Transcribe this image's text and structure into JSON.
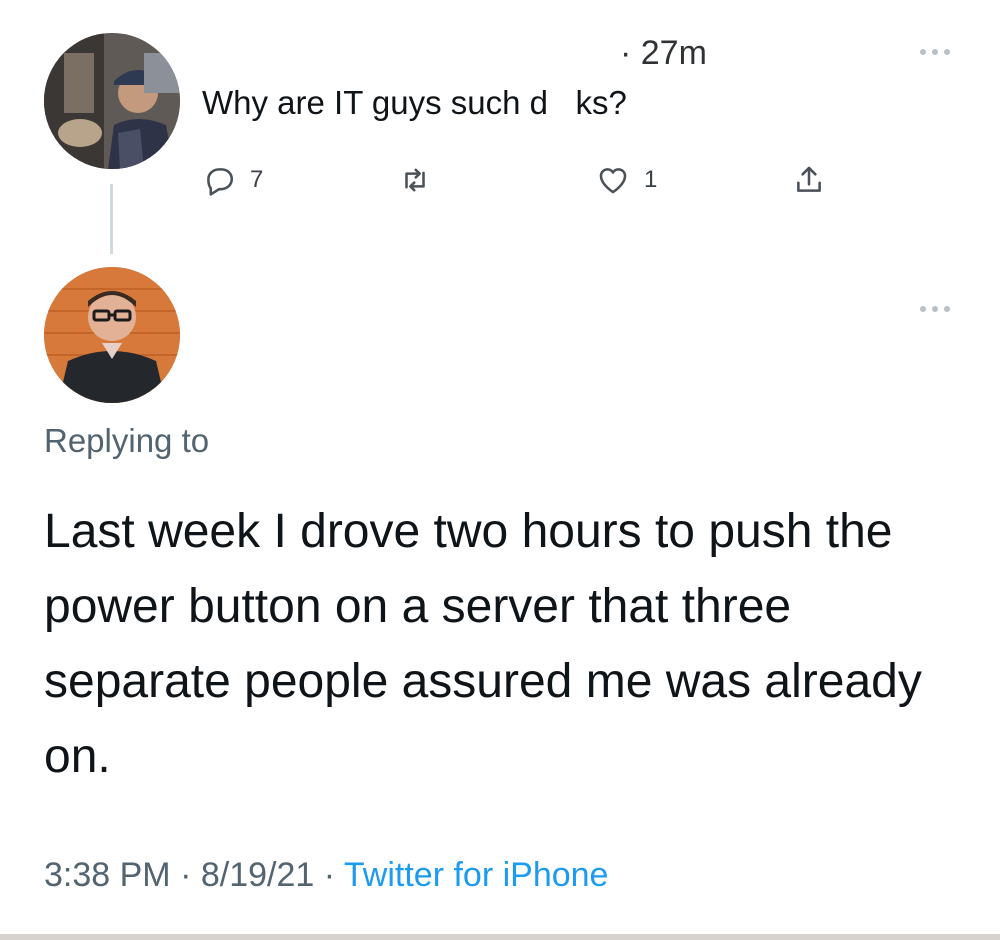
{
  "parent_tweet": {
    "timestamp": "· 27m",
    "text": "Why are IT guys such d   ks?",
    "actions": {
      "reply": {
        "icon": "comment-icon",
        "count": "7"
      },
      "retweet": {
        "icon": "retweet-icon",
        "count": ""
      },
      "like": {
        "icon": "heart-icon",
        "count": "1"
      },
      "share": {
        "icon": "share-icon"
      }
    },
    "more_icon": "more-icon"
  },
  "reply_tweet": {
    "more_icon": "more-icon",
    "replying_to": "Replying to",
    "text": "Last week I drove two hours to push the power button on a server that three separate people assured me was already on.",
    "time": "3:38 PM",
    "date": "8/19/21",
    "source": "Twitter for iPhone",
    "separator": " · "
  },
  "colors": {
    "text": "#0f1419",
    "secondary": "#536471",
    "link": "#1d9bf0"
  }
}
